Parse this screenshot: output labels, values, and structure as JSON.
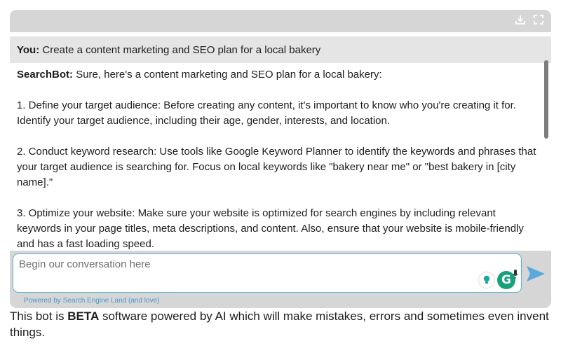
{
  "toolbar": {
    "download_icon": "download-icon",
    "fullscreen_icon": "fullscreen-icon"
  },
  "conversation": {
    "user": {
      "speaker": "You:",
      "text": "Create a content marketing and SEO plan for a local bakery"
    },
    "bot": {
      "speaker": "SearchBot:",
      "intro": "Sure, here's a content marketing and SEO plan for a local bakery:",
      "paragraphs": [
        "1. Define your target audience: Before creating any content, it's important to know who you're creating it for. Identify your target audience, including their age, gender, interests, and location.",
        "2. Conduct keyword research: Use tools like Google Keyword Planner to identify the keywords and phrases that your target audience is searching for. Focus on local keywords like \"bakery near me\" or \"best bakery in [city name].\"",
        "3. Optimize your website: Make sure your website is optimized for search engines by including relevant keywords in your page titles, meta descriptions, and content. Also, ensure that your website is mobile-friendly and has a fast loading speed."
      ]
    }
  },
  "input": {
    "placeholder": "Begin our conversation here",
    "value": ""
  },
  "footer": {
    "powered_by": "Powered by Search Engine Land (and love)"
  },
  "disclaimer": {
    "before": "This bot is ",
    "bold": "BETA",
    "after": " software powered by AI which will make mistakes, errors and sometimes even invent things."
  },
  "colors": {
    "frame": "#d6d6d6",
    "user_bubble": "#e5e5e5",
    "accent": "#58b3d6",
    "send": "#5aa9dc",
    "grammarly": "#15a27b",
    "link": "#4a98c8"
  }
}
